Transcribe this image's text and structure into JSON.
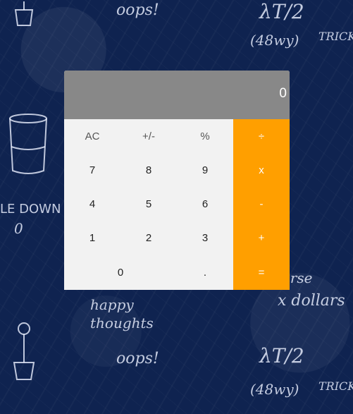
{
  "display": {
    "value": "0"
  },
  "keys": {
    "row1": [
      "AC",
      "+/-",
      "%",
      "÷"
    ],
    "row2": [
      "7",
      "8",
      "9",
      "x"
    ],
    "row3": [
      "4",
      "5",
      "6",
      "-"
    ],
    "row4": [
      "1",
      "2",
      "3",
      "+"
    ],
    "row5": [
      "0",
      ".",
      "="
    ]
  },
  "background_doodles": {
    "oops_top": "oops!",
    "oops_bottom": "oops!",
    "happy": "happy",
    "thoughts": "thoughts",
    "dollars": "x dollars",
    "formula_top": "λT/2",
    "formula_bottom": "λT/2",
    "paren_top": "(48wy)",
    "paren_bottom": "(48wy)",
    "trick_top": "TRICK",
    "trick_bottom": "TRICK",
    "side_text": "LE DOWN",
    "house": "erse",
    "zero_left": "0"
  },
  "colors": {
    "background": "#0f2350",
    "display": "#888888",
    "keypad": "#f2f2f2",
    "operator": "#ff9f00"
  }
}
